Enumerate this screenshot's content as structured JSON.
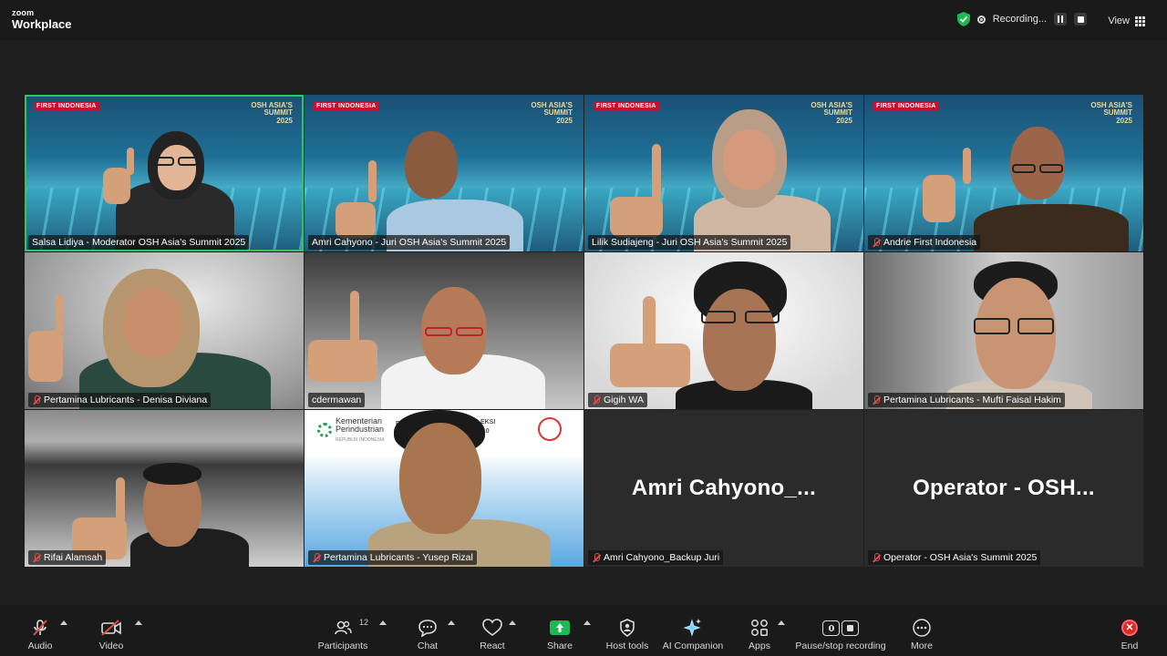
{
  "app": {
    "brand_small": "zoom",
    "brand_big": "Workplace"
  },
  "top": {
    "recording_label": "Recording...",
    "view_label": "View"
  },
  "banner": {
    "first_indonesia": "FIRST INDONESIA",
    "osh_line1": "OSH ASIA'S",
    "osh_line2": "SUMMIT",
    "osh_line3": "2025"
  },
  "kemenperin": {
    "line1": "Kementerian",
    "line2": "Perindustrian",
    "line3": "REPUBLIK INDONESIA",
    "pr": "PR",
    "seleksi1": "ELEKSI",
    "seleksi2": "RI 4.0"
  },
  "participants": [
    {
      "name": "Salsa Lidiya - Moderator OSH Asia's Summit 2025",
      "muted": false
    },
    {
      "name": "Amri Cahyono - Juri OSH Asia's Summit 2025",
      "muted": false
    },
    {
      "name": "Lilik Sudiajeng - Juri OSH Asia's Summit 2025",
      "muted": false
    },
    {
      "name": "Andrie First Indonesia",
      "muted": true
    },
    {
      "name": "Pertamina Lubricants - Denisa Diviana",
      "muted": true
    },
    {
      "name": "cdermawan",
      "muted": false
    },
    {
      "name": "Gigih WA",
      "muted": true
    },
    {
      "name": "Pertamina Lubricants - Mufti Faisal Hakim",
      "muted": true
    },
    {
      "name": "Rifai Alamsah",
      "muted": true
    },
    {
      "name": "Pertamina Lubricants - Yusep Rizal",
      "muted": true
    },
    {
      "name": "Amri Cahyono_Backup Juri",
      "muted": true,
      "big_name": "Amri  Cahyono_..."
    },
    {
      "name": "Operator - OSH Asia's Summit 2025",
      "muted": true,
      "big_name": "Operator  -  OSH..."
    }
  ],
  "toolbar": {
    "audio": "Audio",
    "video": "Video",
    "participants": "Participants",
    "participants_count": "12",
    "chat": "Chat",
    "react": "React",
    "share": "Share",
    "host_tools": "Host tools",
    "ai_companion": "AI Companion",
    "apps": "Apps",
    "pause_stop": "Pause/stop recording",
    "more": "More",
    "end": "End"
  },
  "colors": {
    "active_border": "#28c864",
    "share": "#1db954",
    "end": "#e02828",
    "muted": "#e04c4c"
  }
}
